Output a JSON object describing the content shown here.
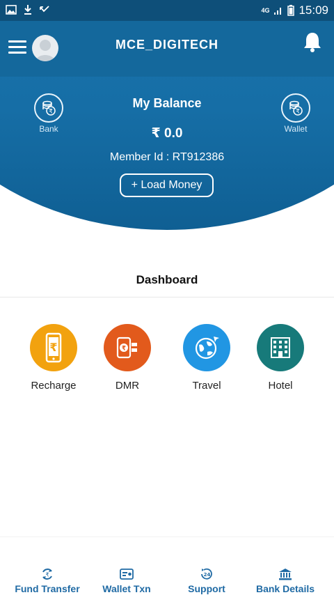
{
  "status_bar": {
    "network": "4G",
    "time": "15:09"
  },
  "app_bar": {
    "title": "MCE_DIGITECH"
  },
  "balance": {
    "title": "My Balance",
    "amount": "₹ 0.0",
    "member_id": "Member Id  : RT912386",
    "load_money_label": "+ Load Money",
    "bank_label": "Bank",
    "wallet_label": "Wallet"
  },
  "dashboard": {
    "title": "Dashboard",
    "tiles": [
      {
        "label": "Recharge",
        "icon": "phone-rupee-icon",
        "color": "#f2a20f"
      },
      {
        "label": "DMR",
        "icon": "money-transfer-icon",
        "color": "#e25a1c"
      },
      {
        "label": "Travel",
        "icon": "globe-plane-icon",
        "color": "#2196e3"
      },
      {
        "label": "Hotel",
        "icon": "hotel-building-icon",
        "color": "#177a7a"
      }
    ]
  },
  "bottom_nav": [
    {
      "label": "Fund Transfer",
      "icon": "fund-transfer-icon"
    },
    {
      "label": "Wallet Txn",
      "icon": "wallet-txn-icon"
    },
    {
      "label": "Support",
      "icon": "support-24-icon"
    },
    {
      "label": "Bank Details",
      "icon": "bank-icon"
    }
  ],
  "colors": {
    "primary": "#14689c",
    "status_bar": "#0e4f79",
    "nav_text": "#1f6aa4"
  }
}
